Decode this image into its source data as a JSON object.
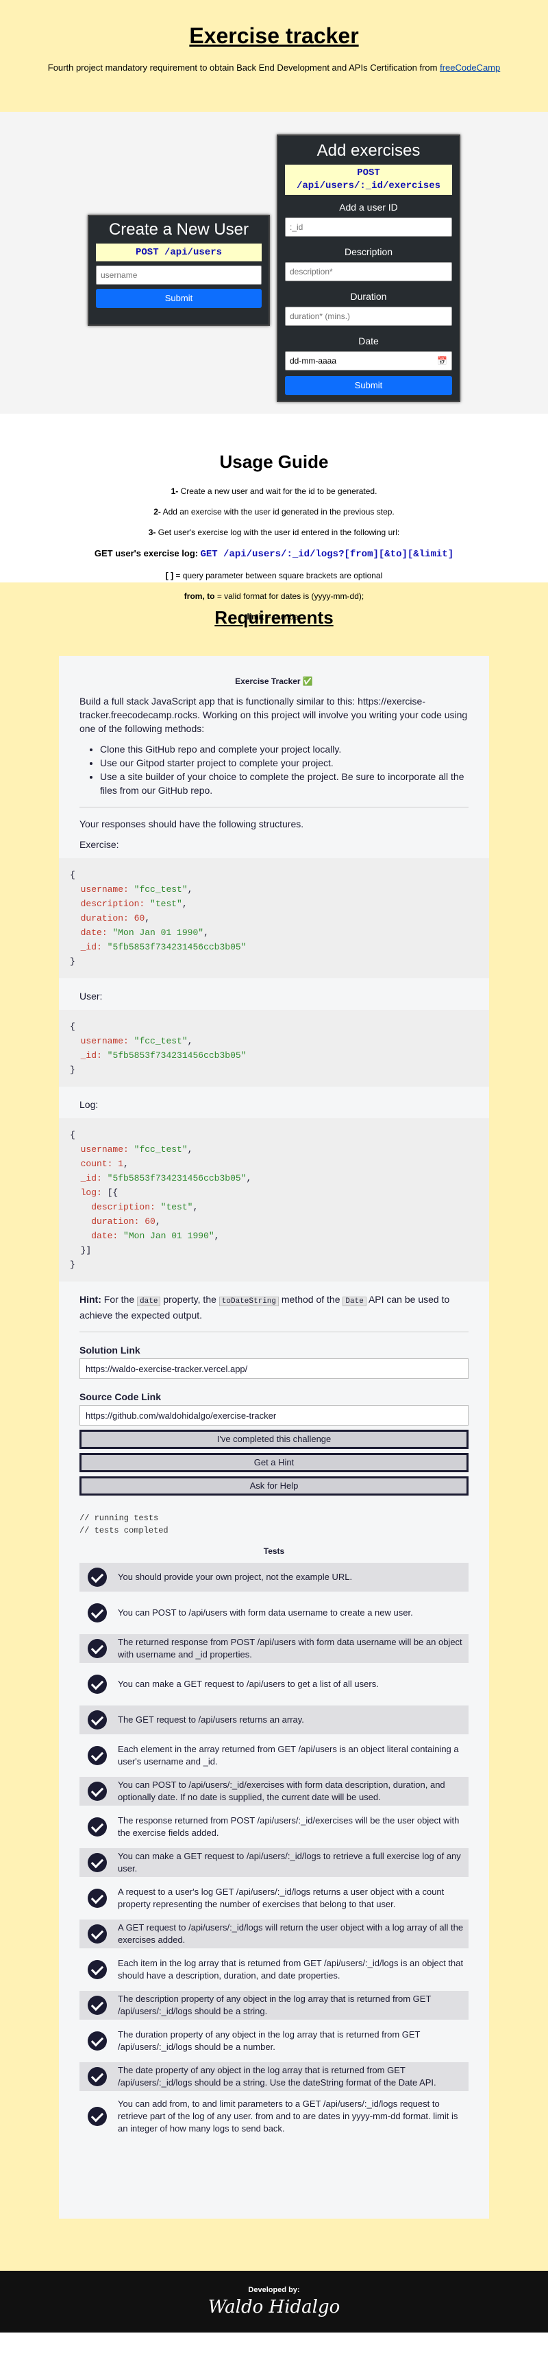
{
  "header": {
    "title": "Exercise tracker",
    "subtitle": "Fourth project mandatory requirement to obtain Back End Development and APIs Certification from",
    "link": "freeCodeCamp"
  },
  "create_user": {
    "title": "Create a New User",
    "endpoint": "POST /api/users",
    "placeholder": "username",
    "submit": "Submit"
  },
  "add_exercise": {
    "title": "Add exercises",
    "endpoint_method": "POST",
    "endpoint_path": "/api/users/:_id/exercises",
    "id_label": "Add a user ID",
    "id_placeholder": ":_id",
    "desc_label": "Description",
    "desc_placeholder": "description*",
    "dur_label": "Duration",
    "dur_placeholder": "duration* (mins.)",
    "date_label": "Date",
    "date_placeholder": "dd-mm-aaaa",
    "submit": "Submit"
  },
  "usage": {
    "title": "Usage Guide",
    "step1_num": "1-",
    "step1": "Create a new user and wait for the id to be generated.",
    "step2_num": "2-",
    "step2": "Add an exercise with the user id generated in the previous step.",
    "step3_num": "3-",
    "step3": "Get user's exercise log with the user id entered in the following url:",
    "log_label": "GET user's exercise log:",
    "log_ep": "GET /api/users/:_id/logs?[from][&to][&limit]",
    "brackets": "[ ]",
    "brackets_text": "= query parameter between square brackets are optional",
    "fromto": "from, to",
    "fromto_text": "= valid format for dates is (yyyy-mm-dd);",
    "limit": "limit",
    "limit_text": "= number"
  },
  "requirements": {
    "title": "Requirements",
    "panel_title": "Exercise Tracker",
    "intro": "Build a full stack JavaScript app that is functionally similar to this: https://exercise-tracker.freecodecamp.rocks. Working on this project will involve you writing your code using one of the following methods:",
    "methods": [
      "Clone this GitHub repo and complete your project locally.",
      "Use our Gitpod starter project to complete your project.",
      "Use a site builder of your choice to complete the project. Be sure to incorporate all the files from our GitHub repo."
    ],
    "structures": "Your responses should have the following structures.",
    "exercise_label": "Exercise:",
    "user_label": "User:",
    "log_label": "Log:",
    "hint": "Hint:",
    "hint_a": "For the",
    "hint_b": "property, the",
    "hint_c": "method of the",
    "hint_d": "API can be used to achieve the expected output.",
    "hint_date": "date",
    "hint_method": "toDateString",
    "hint_api": "Date",
    "solution_label": "Solution Link",
    "solution": "https://waldo-exercise-tracker.vercel.app/",
    "source_label": "Source Code Link",
    "source": "https://github.com/waldohidalgo/exercise-tracker",
    "btn_complete": "I've completed this challenge",
    "btn_hint": "Get a Hint",
    "btn_help": "Ask for Help",
    "console1": "// running tests",
    "console2": "// tests completed",
    "tests_title": "Tests",
    "tests": [
      "You should provide your own project, not the example URL.",
      "You can POST to /api/users with form data username to create a new user.",
      "The returned response from POST /api/users with form data username will be an object with username and _id properties.",
      "You can make a GET request to /api/users to get a list of all users.",
      "The GET request to /api/users returns an array.",
      "Each element in the array returned from GET /api/users is an object literal containing a user's username and _id.",
      "You can POST to /api/users/:_id/exercises with form data description, duration, and optionally date. If no date is supplied, the current date will be used.",
      "The response returned from POST /api/users/:_id/exercises will be the user object with the exercise fields added.",
      "You can make a GET request to /api/users/:_id/logs to retrieve a full exercise log of any user.",
      "A request to a user's log GET /api/users/:_id/logs returns a user object with a count property representing the number of exercises that belong to that user.",
      "A GET request to /api/users/:_id/logs will return the user object with a log array of all the exercises added.",
      "Each item in the log array that is returned from GET /api/users/:_id/logs is an object that should have a description, duration, and date properties.",
      "The description property of any object in the log array that is returned from GET /api/users/:_id/logs should be a string.",
      "The duration property of any object in the log array that is returned from GET /api/users/:_id/logs should be a number.",
      "The date property of any object in the log array that is returned from GET /api/users/:_id/logs should be a string. Use the dateString format of the Date API.",
      "You can add from, to and limit parameters to a GET /api/users/:_id/logs request to retrieve part of the log of any user. from and to are dates in yyyy-mm-dd format. limit is an integer of how many logs to send back."
    ]
  },
  "footer": {
    "developed": "Developed by:",
    "signature": "Waldo Hidalgo"
  }
}
